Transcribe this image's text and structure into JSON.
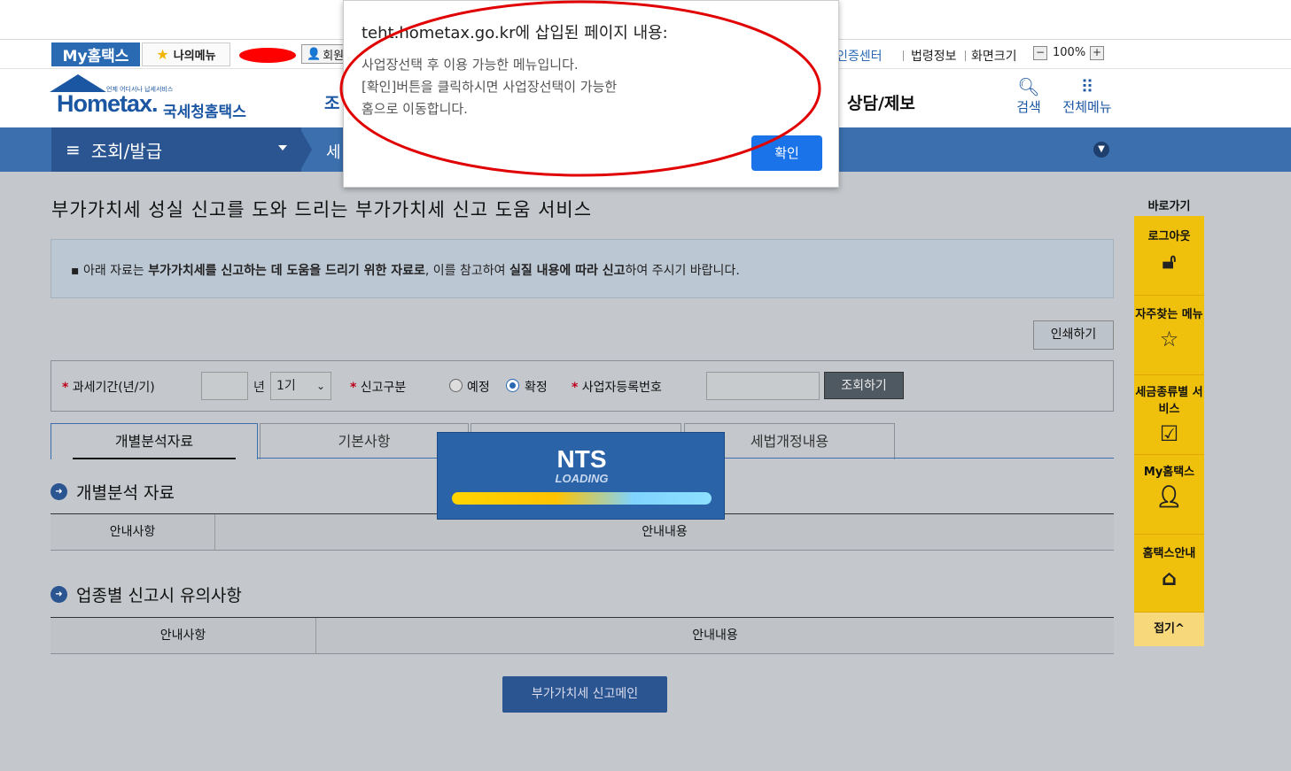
{
  "utility_bar": {
    "my_hometax": "My홈택스",
    "my_menu": "나의메뉴",
    "member": "회원",
    "cert_center": "인증센터",
    "law_info": "법령정보",
    "screen_size": "화면크기",
    "zoom_minus": "−",
    "zoom_value": "100%",
    "zoom_plus": "+"
  },
  "header": {
    "logo_text": "Hometax.",
    "logo_sub": "국세청홈택스",
    "logo_tiny": "언제 어디서나 납세서비스",
    "nav_partial": "조",
    "nav_consult": "상담/제보",
    "search": "검색",
    "all_menu": "전체메뉴"
  },
  "blue_bar": {
    "category": "조회/발급",
    "crumb2": "세"
  },
  "page": {
    "title": "부가가치세 성실 신고를 도와 드리는 부가가치세 신고 도움 서비스",
    "info_prefix": "▪ 아래 자료는 ",
    "info_bold1": "부가가치세를 신고하는 데 도움을 드리기 위한 자료로",
    "info_mid": ", 이를 참고하여 ",
    "info_bold2": "실질 내용에 따라 신고",
    "info_suffix": "하여 주시기 바랍니다.",
    "print_button": "인쇄하기"
  },
  "search": {
    "period_label": "과세기간(년/기)",
    "year_value": "",
    "year_unit": "년",
    "period_value": "1기",
    "type_label": "신고구분",
    "radio_pre": "예정",
    "radio_fix": "확정",
    "bizno_label": "사업자등록번호",
    "bizno_value": "",
    "query_button": "조회하기"
  },
  "tabs": [
    {
      "label": "개별분석자료"
    },
    {
      "label": "기본사항"
    },
    {
      "label": ""
    },
    {
      "label": "세법개정내용"
    }
  ],
  "section1": {
    "title": "개별분석 자료",
    "col1": "안내사항",
    "col2": "안내내용"
  },
  "section2": {
    "title": "업종별 신고시 유의사항",
    "col1": "안내사항",
    "col2": "안내내용"
  },
  "main_button": "부가가치세 신고메인",
  "quick_menu": {
    "label": "바로가기",
    "items": [
      {
        "label": "로그아웃",
        "icon": "unlock-icon"
      },
      {
        "label": "자주찾는 메뉴",
        "icon": "star-icon"
      },
      {
        "label": "세금종류별 서비스",
        "icon": "checkbox-icon"
      },
      {
        "label": "My홈택스",
        "icon": "user-icon"
      },
      {
        "label": "홈택스안내",
        "icon": "home-guide-icon"
      }
    ],
    "fold": "접기^"
  },
  "loading": {
    "brand": "NTS",
    "text": "LOADING"
  },
  "dialog": {
    "title": "teht.hometax.go.kr에 삽입된 페이지 내용:",
    "message": "사업장선택 후 이용 가능한 메뉴입니다.\n[확인]버튼을 클릭하시면 사업장선택이 가능한\n홈으로 이동합니다.",
    "ok_button": "확인"
  },
  "colors": {
    "brand_blue": "#1b56a3",
    "bar_blue": "#3b6fae",
    "quick_yellow": "#f0c10c",
    "dialog_button": "#1a73e8",
    "annotation_red": "#e00000"
  }
}
